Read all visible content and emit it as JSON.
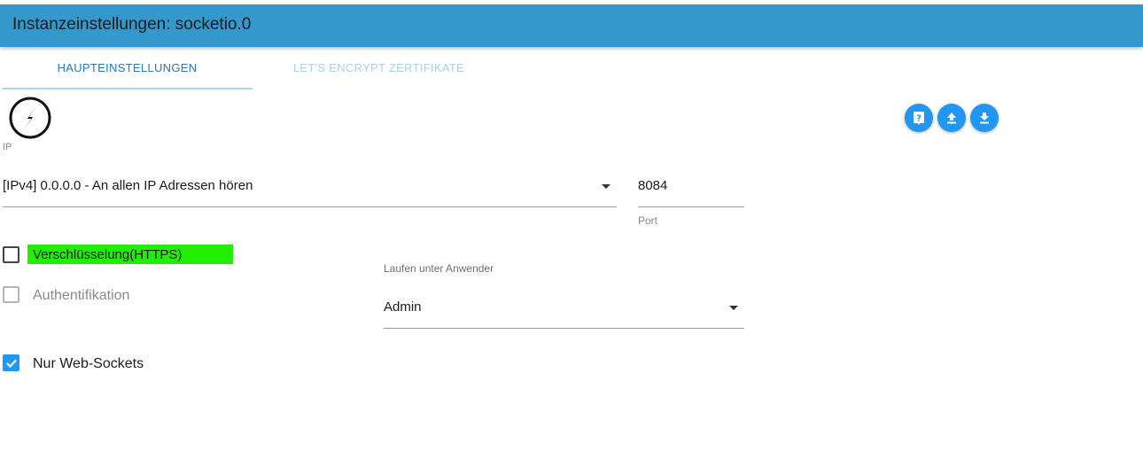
{
  "window": {
    "title": "Instanzeinstellungen: socketio.0"
  },
  "tabs": [
    {
      "label": "HAUPTEINSTELLUNGEN",
      "active": true
    },
    {
      "label": "LET'S ENCRYPT ZERTIFIKATE",
      "active": false
    }
  ],
  "toolbar": {
    "icons": [
      "help-icon",
      "upload-icon",
      "download-icon"
    ]
  },
  "form": {
    "ip_label": "IP",
    "ip_value": "[IPv4] 0.0.0.0 - An allen IP Adressen hören",
    "port_value": "8084",
    "port_label": "Port",
    "https_label": "Verschlüsselung(HTTPS)",
    "https_checked": false,
    "auth_label": "Authentifikation",
    "auth_checked": false,
    "auth_disabled": true,
    "ws_label": "Nur Web-Sockets",
    "ws_checked": true,
    "user_label": "Laufen unter Anwender",
    "user_value": "Admin"
  },
  "colors": {
    "titlebar": "#3399cc",
    "accent": "#2196f3",
    "highlight": "#22ee00"
  }
}
